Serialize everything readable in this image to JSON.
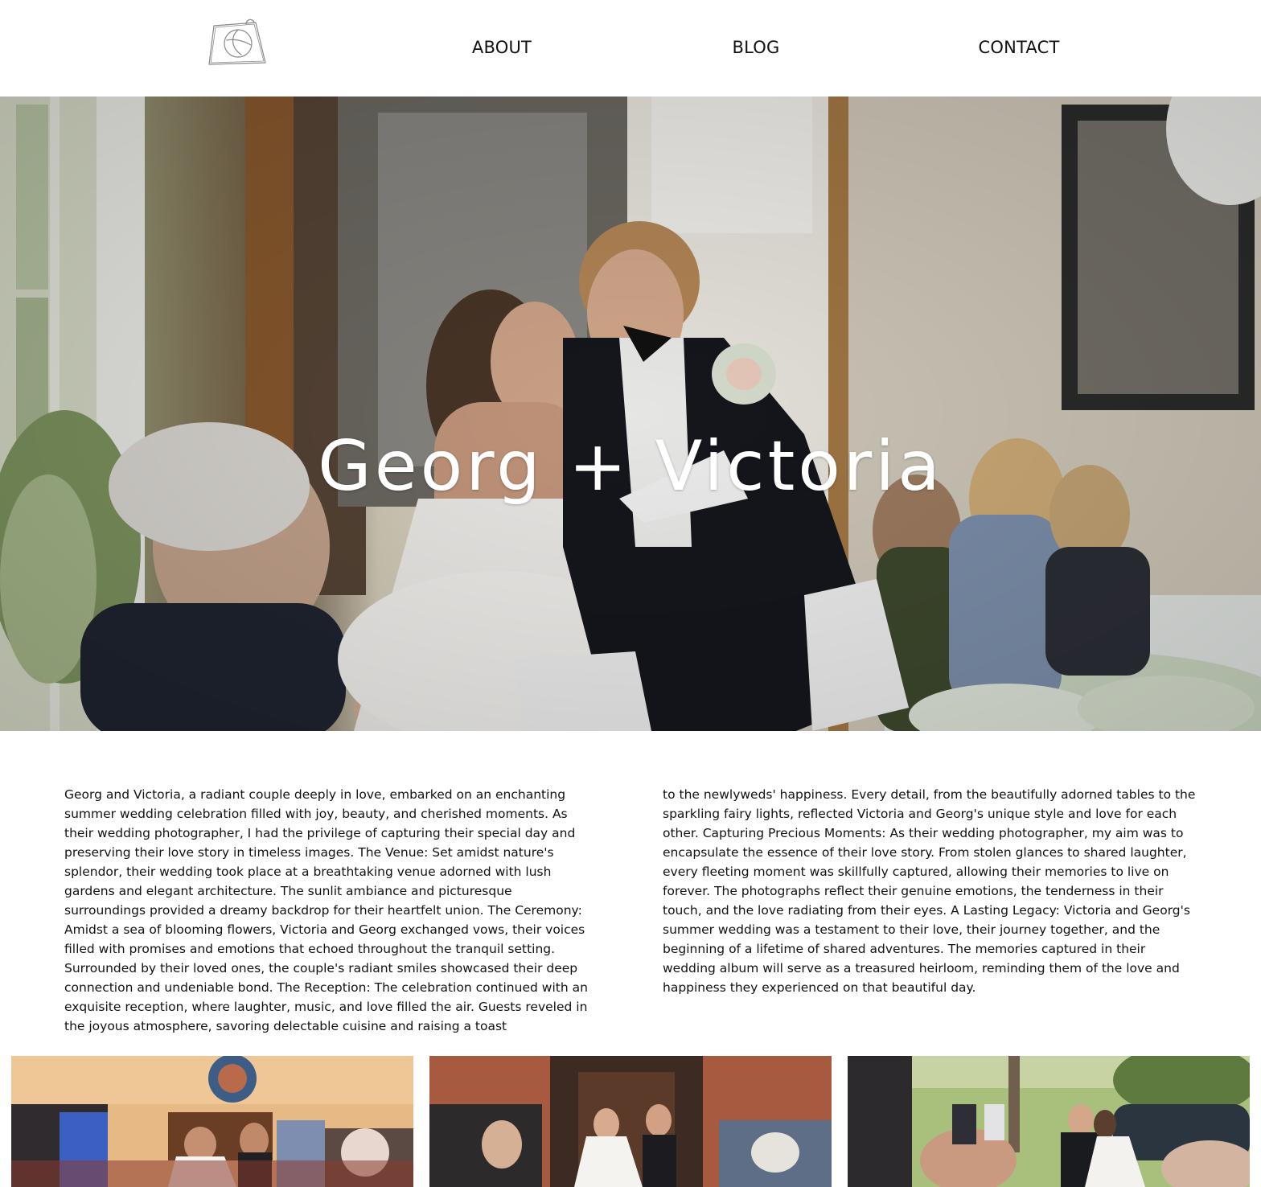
{
  "nav": {
    "logo_icon": "hand-drawn-bag-logo-icon",
    "items": [
      {
        "label": "ABOUT"
      },
      {
        "label": "BLOG"
      },
      {
        "label": "CONTACT"
      }
    ]
  },
  "hero": {
    "title": "Georg + Victoria",
    "image": "bride-and-groom-kissing-at-reception-photo"
  },
  "article": {
    "column_left": "Georg and Victoria, a radiant couple deeply in love, embarked on an enchanting summer wedding celebration filled with joy, beauty, and cherished moments. As their wedding photographer, I had the privilege of capturing their special day and preserving their love story in timeless images. The Venue: Set amidst nature's splendor, their wedding took place at a breathtaking venue adorned with lush gardens and elegant architecture. The sunlit ambiance and picturesque surroundings provided a dreamy backdrop for their heartfelt union. The Ceremony: Amidst a sea of blooming flowers, Victoria and Georg exchanged vows, their voices filled with promises and emotions that echoed throughout the tranquil setting. Surrounded by their loved ones, the couple's radiant smiles showcased their deep connection and undeniable bond. The Reception: The celebration continued with an exquisite reception, where laughter, music, and love filled the air. Guests reveled in the joyous atmosphere, savoring delectable cuisine and raising a toast",
    "column_right": "to the newlyweds' happiness. Every detail, from the beautifully adorned tables to the sparkling fairy lights, reflected Victoria and Georg's unique style and love for each other. Capturing Precious Moments: As their wedding photographer, my aim was to encapsulate the essence of their love story. From stolen glances to shared laughter, every fleeting moment was skillfully captured, allowing their memories to live on forever. The photographs reflect their genuine emotions, the tenderness in their touch, and the love radiating from their eyes. A Lasting Legacy: Victoria and Georg's summer wedding was a testament to their love, their journey together, and the beginning of a lifetime of shared adventures. The memories captured in their wedding album will serve as a treasured heirloom, reminding them of the love and happiness they experienced on that beautiful day."
  },
  "gallery": [
    {
      "image": "church-aisle-recessional-photo"
    },
    {
      "image": "brick-church-doorway-exit-photo"
    },
    {
      "image": "outdoor-kiss-with-guests-photo"
    }
  ],
  "colors": {
    "text": "#111111",
    "background": "#ffffff",
    "hero_title": "#ffffff"
  }
}
